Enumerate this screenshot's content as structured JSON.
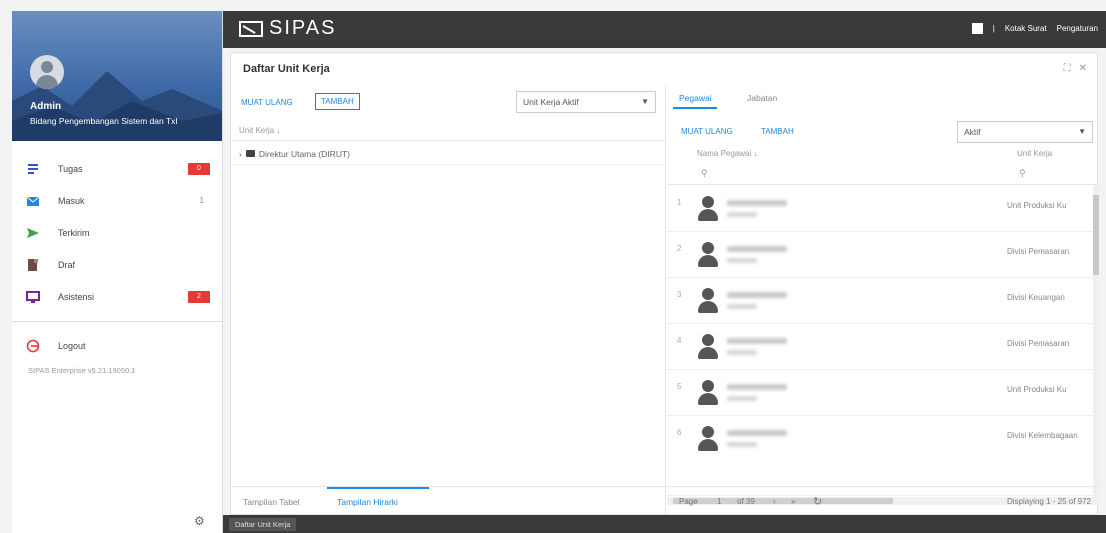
{
  "app": {
    "logo": "SIPAS"
  },
  "topbar": {
    "links": [
      "Kotak Surat",
      "Pengaturan"
    ]
  },
  "profile": {
    "name": "Admin",
    "unit": "Bidang Pengembangan Sistem dan TxI"
  },
  "sidebar": {
    "items": [
      {
        "label": "Tugas",
        "badge": "0",
        "icon": "task-list-icon",
        "color": "#3f51b5"
      },
      {
        "label": "Masuk",
        "count": "1",
        "icon": "inbox-icon",
        "color": "#1e88e5"
      },
      {
        "label": "Terkirim",
        "icon": "send-icon",
        "color": "#43a047"
      },
      {
        "label": "Draf",
        "icon": "draft-icon",
        "color": "#6d4c41"
      },
      {
        "label": "Asistensi",
        "badge": "2",
        "icon": "monitor-icon",
        "color": "#7b1fa2"
      }
    ],
    "logout": "Logout",
    "version": "SIPAS Enterprise v5.21.19050.1"
  },
  "panel": {
    "title": "Daftar Unit Kerja",
    "left": {
      "reload": "MUAT ULANG",
      "add": "TAMBAH",
      "filter": "Unit Kerja Aktif",
      "column": "Unit Kerja ↓",
      "tree_item": "Direktur Utama (DIRUT)",
      "tabs": [
        "Tampilan Tabel",
        "Tampilan Hirarki"
      ]
    },
    "right": {
      "tabs": [
        "Pegawai",
        "Jabatan"
      ],
      "reload": "MUAT ULANG",
      "add": "TAMBAH",
      "filter": "Aktif",
      "columns": [
        "Nama Pegawai ↓",
        "Unit Kerja"
      ],
      "rows": [
        {
          "num": "1",
          "unit": "Unit Produksi Ku"
        },
        {
          "num": "2",
          "unit": "Divisi Pemasaran"
        },
        {
          "num": "3",
          "unit": "Divisi Keuangan"
        },
        {
          "num": "4",
          "unit": "Divisi Pemasaran"
        },
        {
          "num": "5",
          "unit": "Unit Produksi Ku"
        },
        {
          "num": "6",
          "unit": "Divisi Kelembagaan"
        }
      ],
      "pager": {
        "page_label": "Page",
        "page": "1",
        "of": "of 39",
        "display": "Displaying 1 - 25 of 972"
      }
    }
  },
  "taskbar": {
    "item": "Daftar Unit Kerja"
  }
}
